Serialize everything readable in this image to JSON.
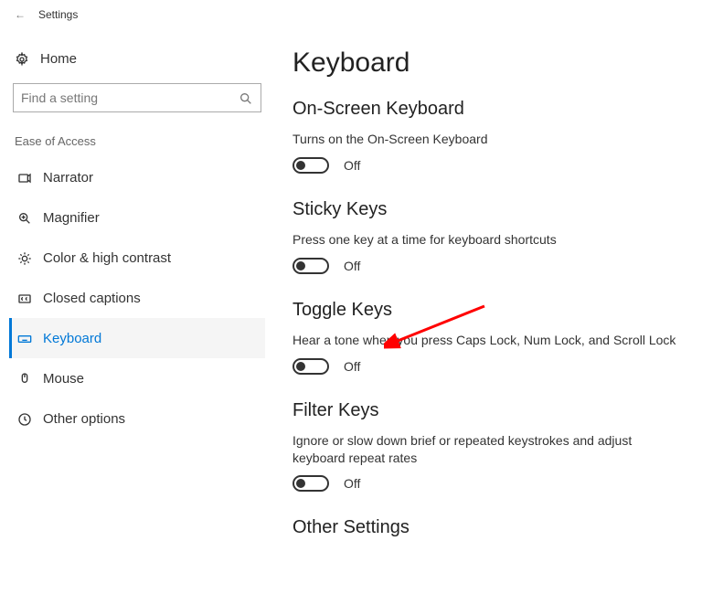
{
  "titlebar": {
    "back_glyph": "←",
    "app_title": "Settings"
  },
  "sidebar": {
    "home_label": "Home",
    "search_placeholder": "Find a setting",
    "group_label": "Ease of Access",
    "items": [
      {
        "icon_name": "narrator-icon",
        "label": "Narrator"
      },
      {
        "icon_name": "magnifier-icon",
        "label": "Magnifier"
      },
      {
        "icon_name": "contrast-icon",
        "label": "Color & high contrast"
      },
      {
        "icon_name": "captions-icon",
        "label": "Closed captions"
      },
      {
        "icon_name": "keyboard-icon",
        "label": "Keyboard"
      },
      {
        "icon_name": "mouse-icon",
        "label": "Mouse"
      },
      {
        "icon_name": "options-icon",
        "label": "Other options"
      }
    ]
  },
  "page": {
    "title": "Keyboard",
    "sections": {
      "osk": {
        "heading": "On-Screen Keyboard",
        "desc": "Turns on the On-Screen Keyboard",
        "state": "Off"
      },
      "sticky": {
        "heading": "Sticky Keys",
        "desc": "Press one key at a time for keyboard shortcuts",
        "state": "Off"
      },
      "toggle": {
        "heading": "Toggle Keys",
        "desc": "Hear a tone when you press Caps Lock, Num Lock, and Scroll Lock",
        "state": "Off"
      },
      "filter": {
        "heading": "Filter Keys",
        "desc": "Ignore or slow down brief or repeated keystrokes and adjust keyboard repeat rates",
        "state": "Off"
      },
      "other": {
        "heading": "Other Settings"
      }
    }
  }
}
